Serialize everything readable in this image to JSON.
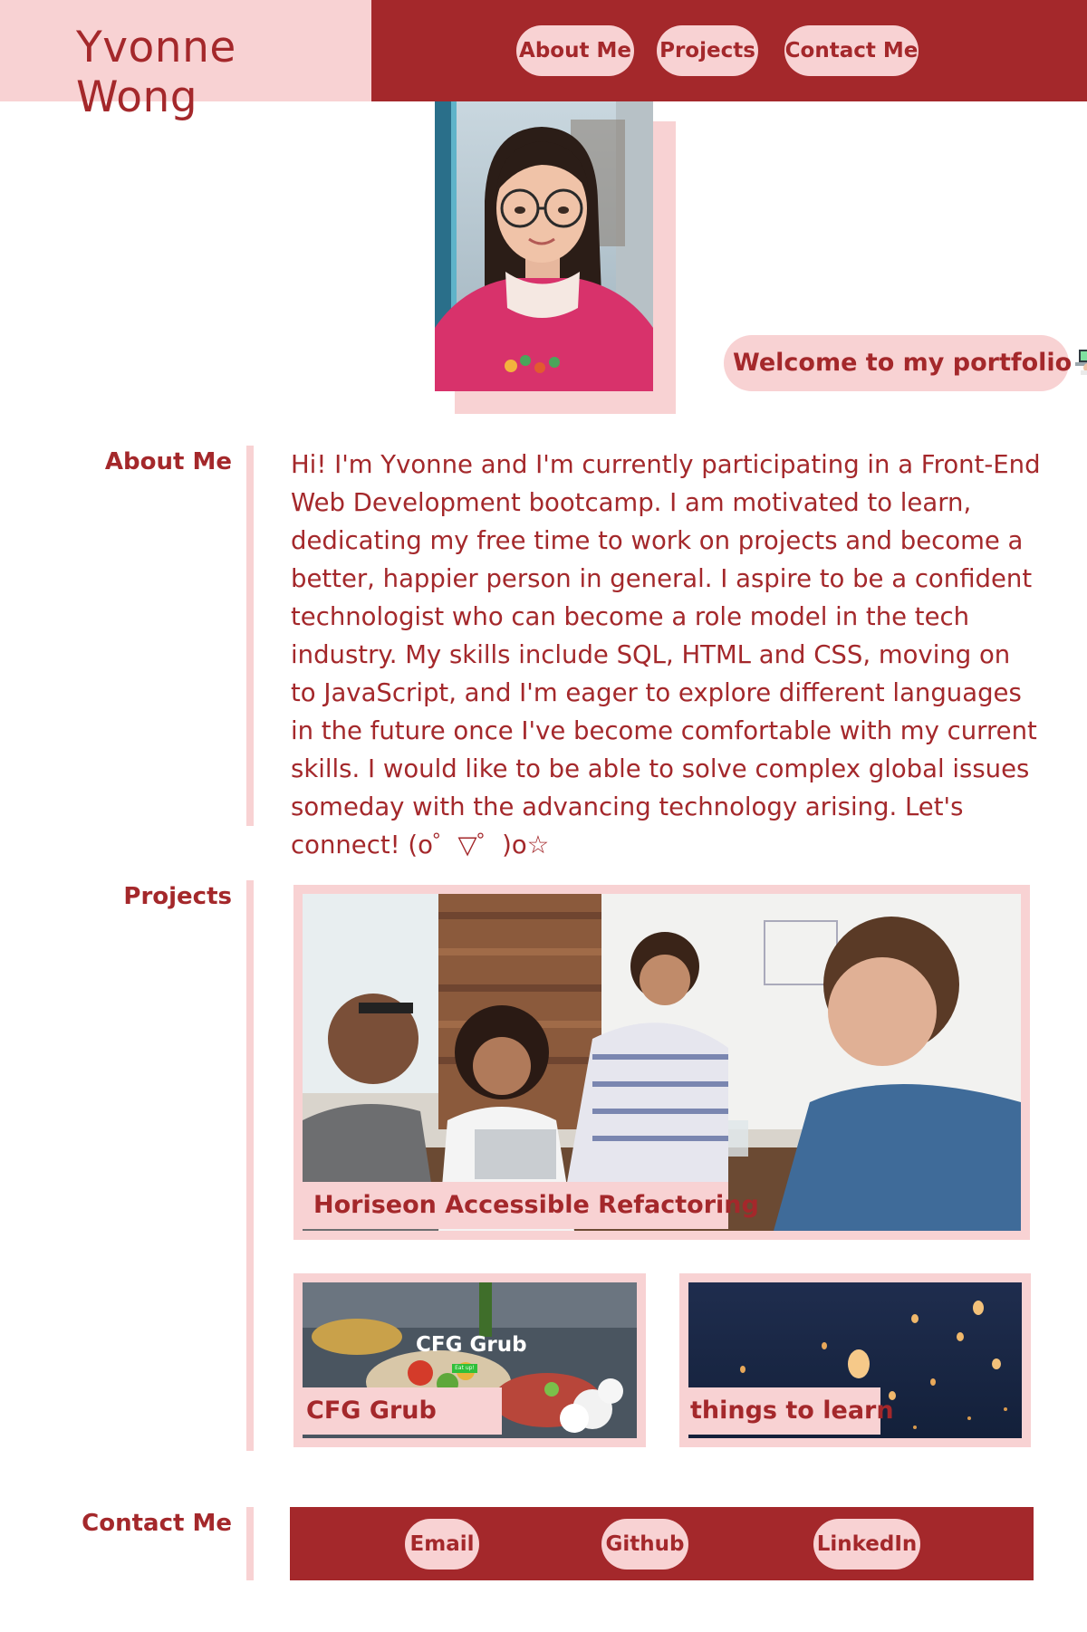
{
  "header": {
    "name": "Yvonne Wong",
    "nav": [
      "About Me",
      "Projects",
      "Contact Me"
    ]
  },
  "hero": {
    "welcome": "Welcome to my portfolio",
    "welcome_icon": "laptop-technologist-emoji"
  },
  "about": {
    "heading": "About Me",
    "text": "Hi! I'm Yvonne and I'm currently participating in a Front-End Web Development bootcamp. I am motivated to learn, dedicating my free time to work on projects and become a better, happier person in general. I aspire to be a confident technologist who can become a role model in the tech industry. My skills include SQL, HTML and CSS, moving on to JavaScript, and I'm eager to explore different languages in the future once I've become comfortable with my current skills. I would like to be able to solve complex global issues someday with the advancing technology arising. Let's connect! (o゜▽゜)o☆"
  },
  "projects": {
    "heading": "Projects",
    "items": [
      {
        "title": "Horiseon Accessible Refactoring"
      },
      {
        "title": "CFG Grub",
        "image_text": "CFG Grub",
        "image_button": "Eat up!"
      },
      {
        "title": "things to learn"
      }
    ]
  },
  "contact": {
    "heading": "Contact Me",
    "links": [
      "Email",
      "Github",
      "LinkedIn"
    ]
  },
  "colors": {
    "primary": "#a4282b",
    "secondary": "#f8d2d3",
    "background": "#ffffff"
  }
}
